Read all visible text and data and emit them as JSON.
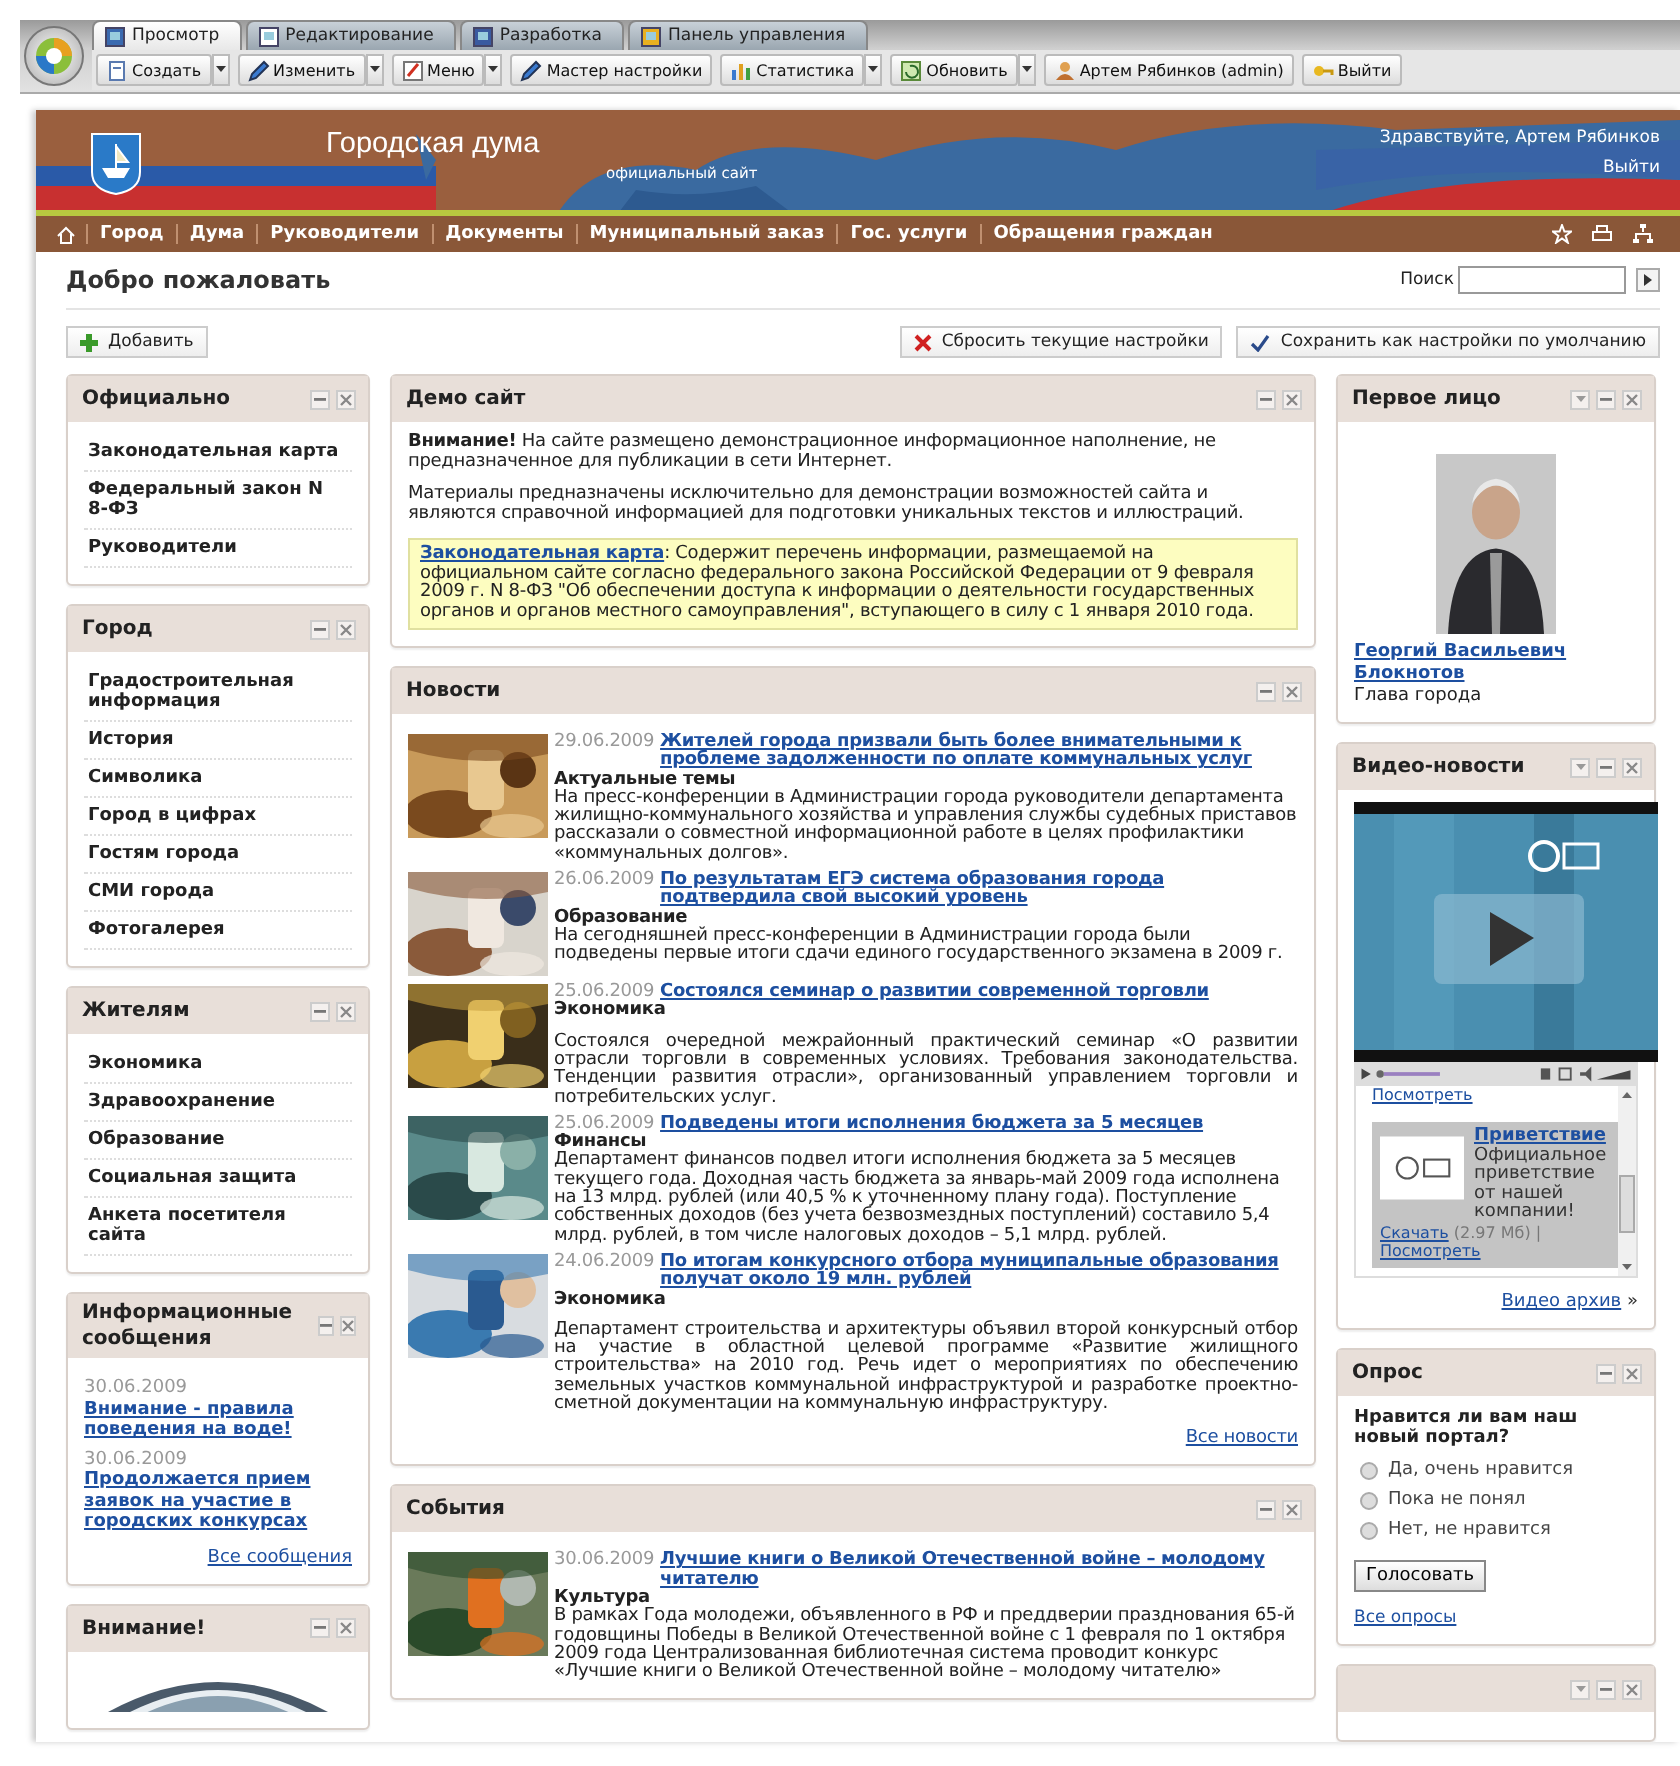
{
  "app_tabs": [
    {
      "label": "Просмотр",
      "selected": true
    },
    {
      "label": "Редактирование",
      "selected": false
    },
    {
      "label": "Разработка",
      "selected": false
    },
    {
      "label": "Панель управления",
      "selected": false
    }
  ],
  "toolbar": [
    {
      "label": "Создать",
      "dropdown": true
    },
    {
      "label": "Изменить",
      "dropdown": true
    },
    {
      "label": "Меню",
      "dropdown": true
    },
    {
      "label": "Мастер настройки",
      "dropdown": false
    },
    {
      "label": "Статистика",
      "dropdown": true
    },
    {
      "label": "Обновить",
      "dropdown": true
    },
    {
      "label": "Артем Рябинков (admin)",
      "dropdown": false
    },
    {
      "label": "Выйти",
      "dropdown": false
    }
  ],
  "header": {
    "title": "Городская дума",
    "subtitle": "официальный сайт",
    "greeting": "Здравствуйте, Артем Рябинков",
    "logout": "Выйти"
  },
  "nav": [
    "Город",
    "Дума",
    "Руководители",
    "Документы",
    "Муниципальный заказ",
    "Гос. услуги",
    "Обращения граждан"
  ],
  "page_title": "Добро пожаловать",
  "search": {
    "label": "Поиск"
  },
  "add_button": "Добавить",
  "reset_button": "Сбросить текущие настройки",
  "save_button": "Сохранить как настройки по умолчанию",
  "left": [
    {
      "kind": "links",
      "title": "Официально",
      "items": [
        "Законодательная карта",
        "Федеральный закон N 8-ФЗ",
        "Руководители"
      ]
    },
    {
      "kind": "links",
      "title": "Город",
      "items": [
        "Градостроительная информация",
        "История",
        "Символика",
        "Город в цифрах",
        "Гостям города",
        "СМИ города",
        "Фотогалерея"
      ]
    },
    {
      "kind": "links",
      "title": "Жителям",
      "items": [
        "Экономика",
        "Здравоохранение",
        "Образование",
        "Социальная защита",
        "Анкета посетителя сайта"
      ]
    },
    {
      "kind": "messages",
      "title": "Информационные сообщения",
      "items": [
        {
          "date": "30.06.2009",
          "link": "Внимание - правила поведения на воде!"
        },
        {
          "date": "30.06.2009",
          "link": "Продолжается прием заявок на участие в городских конкурсах"
        }
      ],
      "more": "Все сообщения"
    },
    {
      "kind": "picture",
      "title": "Внимание!"
    }
  ],
  "center": [
    {
      "kind": "text",
      "title": "Демо сайт",
      "paragraphs": [
        "**Внимание!** На сайте размещено демонстрационное информационное наполнение, не предназначенное для публикации в сети Интернет.",
        "Материалы предназначены исключительно для демонстрации возможностей сайта и являются справочной информацией для подготовки уникальных текстов и иллюстраций."
      ],
      "note": {
        "link": "Законодательная карта",
        "text": ": Содержит перечень информации, размещаемой на официальном сайте согласно федерального закона Российской Федерации от 9 февраля 2009 г. N 8-ФЗ \"Об обеспечении доступа к информации о деятельности государственных органов и органов местного самоуправления\", вступающего в силу с 1 января 2010 года."
      }
    },
    {
      "kind": "news",
      "title": "Новости",
      "items": [
        {
          "date": "29.06.2009",
          "title": "Жителей города призвали быть более внимательными к проблеме задолженности по оплате коммунальных услуг",
          "category": "Актуальные темы",
          "text": "На пресс-конференции в Администрации города руководители департамента жилищно-коммунального хозяйства и управления службы судебных приставов рассказали о совместной информационной работе в целях профилактики «коммунальных долгов».",
          "text_gap": false
        },
        {
          "date": "26.06.2009",
          "title": "По результатам ЕГЭ система образования города подтвердила свой высокий уровень",
          "category": "Образование",
          "text": "На сегодняшней пресс-конференции в Администрации города были подведены первые итоги сдачи единого государственного экзамена в 2009 г.",
          "text_gap": false
        },
        {
          "date": "25.06.2009",
          "title": "Состоялся семинар о развитии современной торговли",
          "category": "Экономика",
          "text": "Состоялся очередной межрайонный практический семинар «О развитии отрасли торговли в современных условиях. Требования законодательства. Тенденции развития отрасли», организованный управлением торговли и потребительских услуг.",
          "text_gap": true
        },
        {
          "date": "25.06.2009",
          "title": "Подведены итоги исполнения бюджета за 5 месяцев",
          "category": "Финансы",
          "text": "Департамент финансов подвел итоги исполнения бюджета за 5 месяцев текущего года. Доходная часть бюджета за январь-май 2009 года исполнена на 13 млрд. рублей (или 40,5 % к уточненному плану года). Поступление собственных доходов (без учета безвозмездных поступлений) составило 5,4 млрд. рублей, в том числе налоговых доходов – 5,1 млрд. рублей.",
          "text_gap": false
        },
        {
          "date": "24.06.2009",
          "title": "По итогам конкурсного отбора муниципальные образования получат около 19 млн. рублей",
          "category": "Экономика",
          "text": "Департамент строительства и архитектуры объявил второй конкурсный отбор на участие в областной целевой программе «Развитие жилищного строительства» на 2010 год. Речь идет о мероприятиях по обеспечению земельных участков коммунальной инфраструктурой и разработке проектно-сметной документации на коммунальную инфраструктуру.",
          "text_gap": true
        }
      ],
      "more": "Все новости"
    },
    {
      "kind": "news",
      "title": "События",
      "items": [
        {
          "date": "30.06.2009",
          "title": "Лучшие книги о Великой Отечественной войне – молодому читателю",
          "category": "Культура",
          "text": "В рамках Года молодежи, объявленного в РФ и преддверии празднования  65-й годовщины Победы в Великой Отечественной войне с 1 февраля по 1 октября 2009 года Централизованная библиотечная система проводит конкурс «Лучшие книги о Великой Отечественной войне – молодому читателю»",
          "text_gap": false
        }
      ]
    }
  ],
  "right": [
    {
      "kind": "person",
      "title": "Первое лицо",
      "has_menu": true,
      "name": "Георгий Васильевич Блокнотов",
      "role": "Глава города"
    },
    {
      "kind": "video",
      "title": "Видео-новости",
      "has_menu": true,
      "top_link": "Посмотреть",
      "playlist": [
        {
          "title": "Приветствие",
          "text": "Официальное приветствие от нашей компании!",
          "download": "Скачать",
          "size": "(2.97 Мб)",
          "separator": "|",
          "view": "Посмотреть",
          "selected": true
        }
      ],
      "more": "Видео архив",
      "more_mark": "»"
    },
    {
      "kind": "poll",
      "title": "Опрос",
      "has_menu": false,
      "question": "Нравится ли вам наш новый портал?",
      "options": [
        {
          "label": "Да, очень нравится",
          "selected": false
        },
        {
          "label": "Пока не понял",
          "selected": false
        },
        {
          "label": "Нет, не нравится",
          "selected": false
        }
      ],
      "button": "Голосовать",
      "more": "Все опросы"
    },
    {
      "kind": "stub",
      "has_menu": true
    }
  ]
}
